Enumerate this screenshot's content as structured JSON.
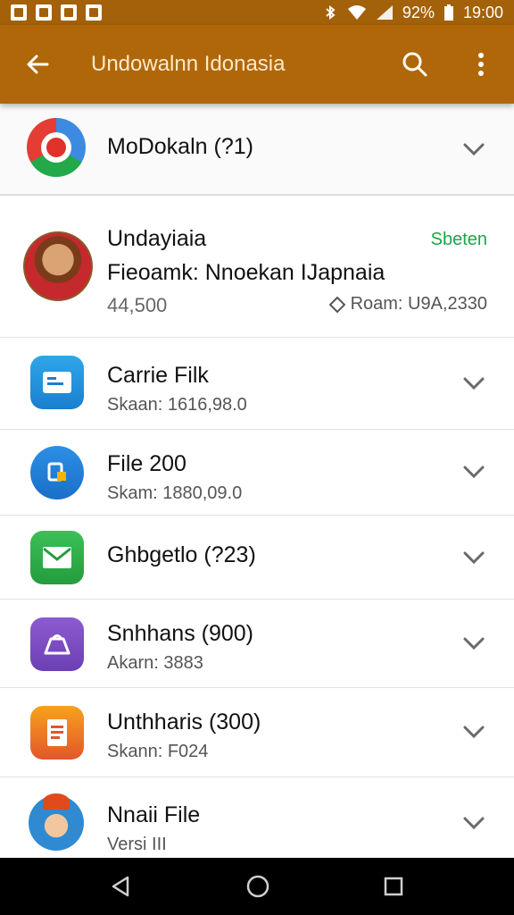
{
  "status_bar": {
    "battery": "92%",
    "time": "19:00"
  },
  "app_bar": {
    "title": "Undowalnn Idonasia"
  },
  "items": [
    {
      "name": "MoDokaln (?1)"
    },
    {
      "name": "Carrie Filk",
      "sub": "Skaan: 1616,98.0"
    },
    {
      "name": "File 200",
      "sub": "Skam: 1880,09.0"
    },
    {
      "name": "Ghbgetlo (?23)"
    },
    {
      "name": "Snhhans (900)",
      "sub": "Akarn: 3883"
    },
    {
      "name": "Unthharis (300)",
      "sub": "Skann: F024"
    },
    {
      "name": "Nnaii File",
      "sub": "Versi III"
    }
  ],
  "profile": {
    "name": "Undayiaia",
    "status": "Sbeten",
    "title": "Fieoamk: Nnoekan IJapnaia",
    "count": "44,500",
    "rank": "Roam: U9A,2330"
  },
  "colors": {
    "brand": "#b0670a",
    "status_green": "#1ea44a"
  },
  "icons": [
    "back-arrow-icon",
    "search-icon",
    "more-vert-icon",
    "chevron-down-icon"
  ]
}
